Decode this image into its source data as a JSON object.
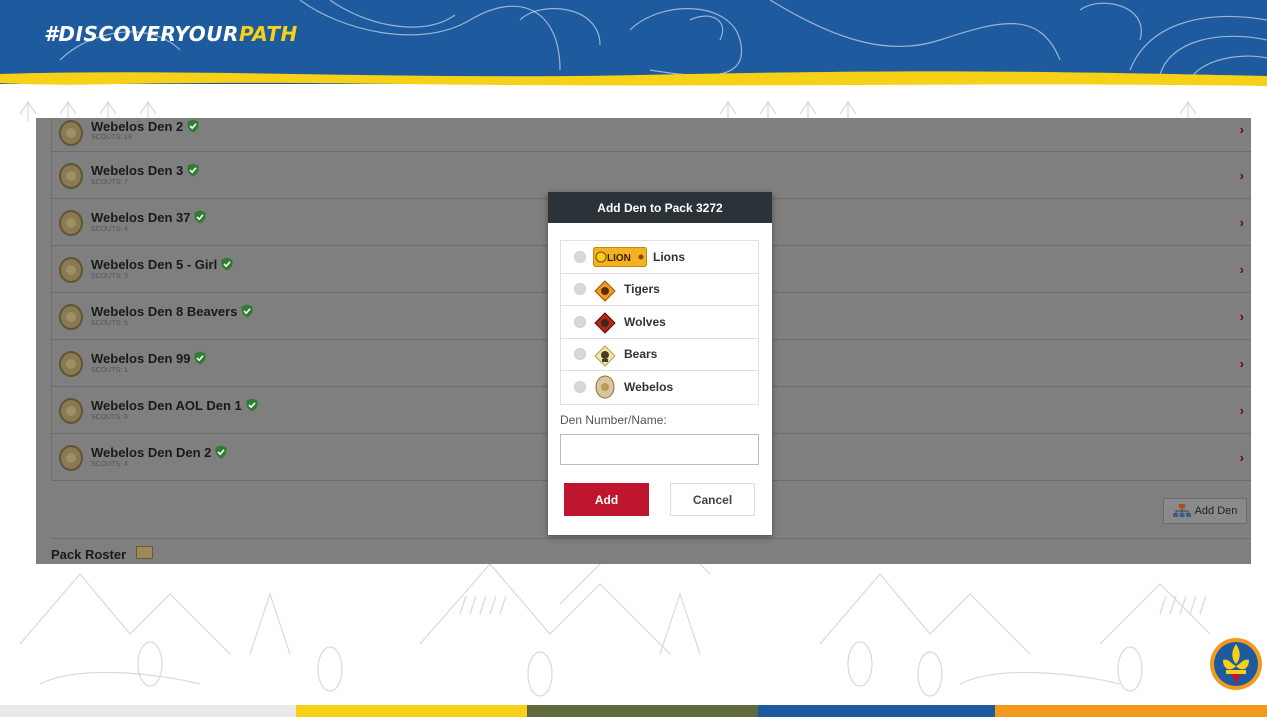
{
  "slide": {
    "hashtag_main": "#DISCOVERYOUR",
    "hashtag_accent": "PATH"
  },
  "dens": [
    {
      "name": "Webelos Den 2",
      "scouts": "SCOUTS: 19"
    },
    {
      "name": "Webelos Den 3",
      "scouts": "SCOUTS: 7"
    },
    {
      "name": "Webelos Den 37",
      "scouts": "SCOUTS: 4"
    },
    {
      "name": "Webelos Den 5 - Girl",
      "scouts": "SCOUTS: 3"
    },
    {
      "name": "Webelos Den 8 Beavers",
      "scouts": "SCOUTS: 5"
    },
    {
      "name": "Webelos Den 99",
      "scouts": "SCOUTS: 1"
    },
    {
      "name": "Webelos Den AOL Den 1",
      "scouts": "SCOUTS: 6"
    },
    {
      "name": "Webelos Den Den 2",
      "scouts": "SCOUTS: 4"
    }
  ],
  "add_den_button": "Add Den",
  "pack_roster": "Pack Roster",
  "modal": {
    "title": "Add Den to Pack 3272",
    "options": [
      {
        "label": "Lions",
        "badge_text": "LION"
      },
      {
        "label": "Tigers"
      },
      {
        "label": "Wolves"
      },
      {
        "label": "Bears"
      },
      {
        "label": "Webelos"
      }
    ],
    "den_field_label": "Den Number/Name:",
    "den_field_value": "",
    "add_label": "Add",
    "cancel_label": "Cancel"
  },
  "colors": {
    "banner_blue": "#1e5b9e",
    "accent_yellow": "#f7d117",
    "modal_header": "#2b3338",
    "add_button_red": "#c0152f",
    "verified_green": "#2e7d32",
    "chevron_red": "#7a0000",
    "stripe_colors": [
      "#e9e9e9",
      "#f7d117",
      "#5f6b3d",
      "#1e5b9e",
      "#f39a1e"
    ]
  },
  "icons": {
    "verified": "shield-check-icon",
    "chevron": "chevron-right-icon",
    "add_den": "org-chart-icon",
    "roster": "roster-card-icon"
  }
}
